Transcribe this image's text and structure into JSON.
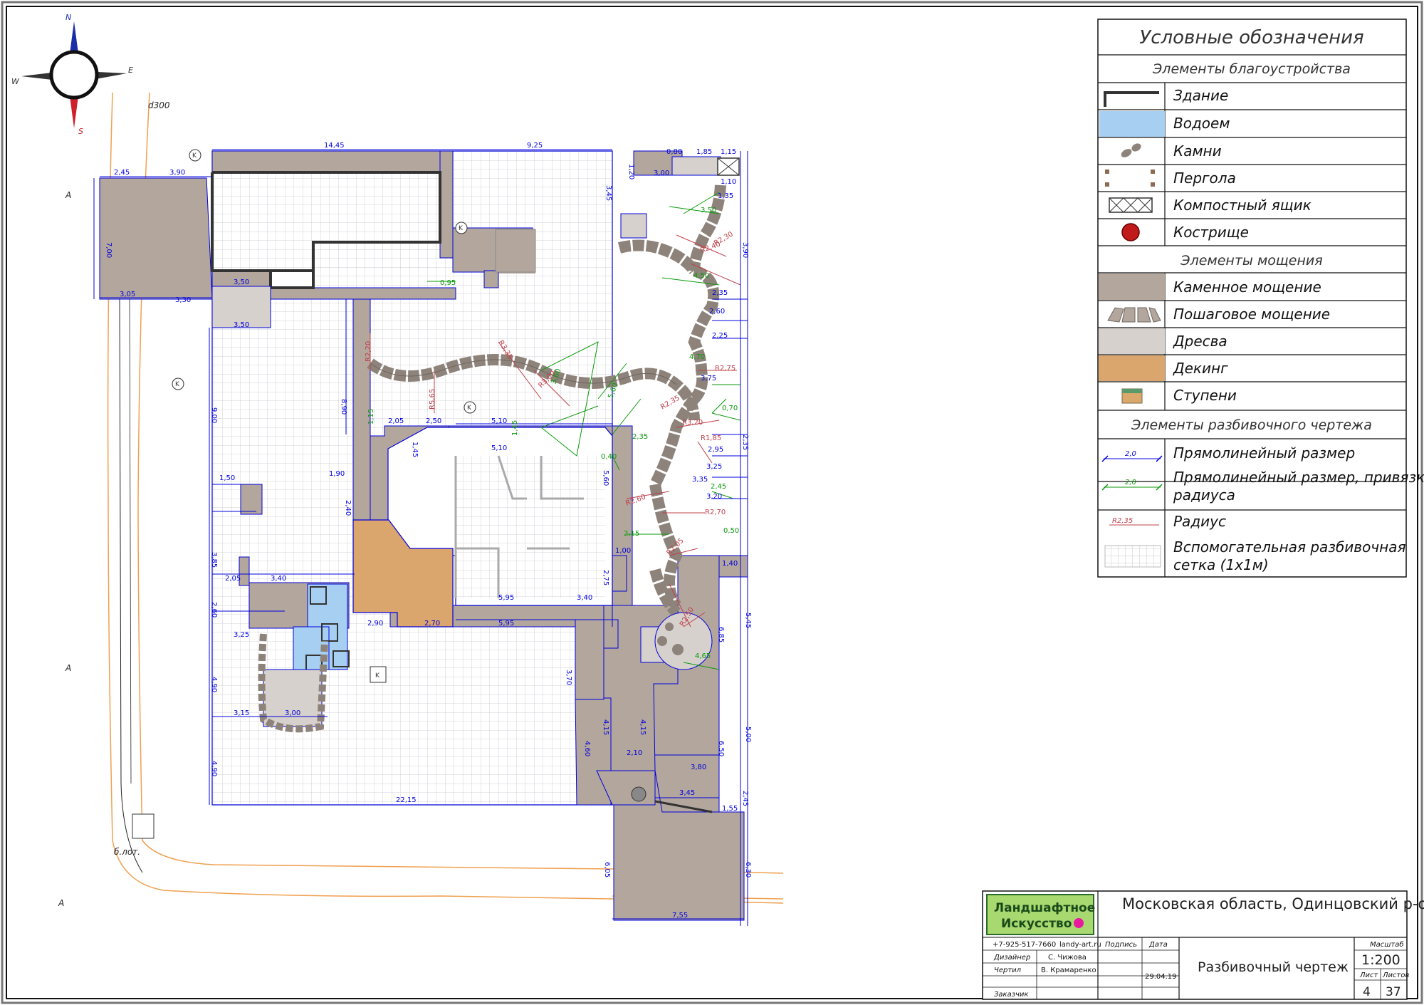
{
  "compass": {
    "n": "N",
    "e": "E",
    "s": "S",
    "w": "W"
  },
  "site_labels": {
    "pipe": "d300",
    "lot": "б.лот.",
    "a1": "A",
    "a2": "A",
    "a3": "A",
    "k1": "K",
    "k2": "K",
    "k3": "K",
    "k4": "K",
    "k5": "K"
  },
  "dims": {
    "d_1445": "14,45",
    "d_925": "9,25",
    "d_245": "2,45",
    "d_390": "3,90",
    "d_700": "7,00",
    "d_305": "3,05",
    "d_330": "3,30",
    "d_350a": "3,50",
    "d_350b": "3,50",
    "d_900": "9,00",
    "d_890": "8,90",
    "d_150": "1,50",
    "d_385": "3,85",
    "d_205": "2,05",
    "d_340": "3,40",
    "d_260": "2,60",
    "d_325": "3,25",
    "d_490a": "4,90",
    "d_490b": "4,90",
    "d_315": "3,15",
    "d_300": "3,00",
    "d_2215": "22,15",
    "d_510a": "5,10",
    "d_510b": "5,10",
    "d_595a": "5,95",
    "d_595b": "5,95",
    "d_340b": "3,40",
    "d_290": "2,90",
    "d_270": "2,70",
    "d_560": "5,60",
    "d_275": "2,75",
    "d_370": "3,70",
    "d_415a": "4,15",
    "d_415b": "4,15",
    "d_460": "4,60",
    "d_210": "2,10",
    "d_380": "3,80",
    "d_345": "3,45",
    "d_755": "7,55",
    "d_605": "6,05",
    "d_630": "6,30",
    "d_545": "5,45",
    "d_685": "6,85",
    "d_650": "6,50",
    "d_500": "5,00",
    "d_390b": "3,90",
    "d_235": "2,35",
    "d_295": "2,95",
    "d_325b": "3,25",
    "d_335": "3,35",
    "d_320": "3,20",
    "d_225": "2,25",
    "d_375": "3,75",
    "d_260b": "2,60",
    "d_235b": "2,35",
    "d_135": "1,35",
    "d_300b": "3,00",
    "d_110": "1,10",
    "d_080": "0,80",
    "d_185": "1,85",
    "d_115": "1,15",
    "d_120": "1,20",
    "d_345b": "3,45",
    "d_240": "2,40",
    "d_190": "1,90",
    "d_250": "2,50",
    "d_205b": "2,05",
    "d_145": "1,45",
    "d_100": "1,00",
    "d_140": "1,40",
    "d_155": "1,55",
    "d_245b": "2,45"
  },
  "radii": {
    "r1": "R2,20",
    "r2": "R3,35",
    "r3": "R5,65",
    "r4": "R3,00",
    "r5": "R2,40",
    "r6": "R2,30",
    "r7": "R2,75",
    "r8": "R2,35",
    "r9": "R3,20",
    "r10": "R1,85",
    "r11": "R2,60",
    "r12": "R2,70",
    "r13": "R2,05",
    "r14": "R2,50"
  },
  "green_dims": {
    "g1": "0,95",
    "g2": "3,60",
    "g3": "5,60",
    "g4": "4,70",
    "g5": "4,50",
    "g6": "3,50",
    "g7": "2,35",
    "g8": "0,50",
    "g9": "2,45",
    "g10": "2,15",
    "g11": "0,70",
    "g12": "4,65",
    "g13": "1,45",
    "g14": "0,40",
    "g15": "1,15"
  },
  "legend": {
    "title": "Условные обозначения",
    "section_landscape": "Элементы благоустройства",
    "building": "Здание",
    "pond": "Водоем",
    "stones": "Камни",
    "pergola": "Пергола",
    "compost": "Компостный ящик",
    "firepit": "Кострище",
    "section_paving": "Элементы мощения",
    "stone_paving": "Каменное мощение",
    "step_paving": "Пошаговое мощение",
    "wood_chips": "Дресва",
    "decking": "Декинг",
    "steps": "Ступени",
    "section_layout": "Элементы разбивочного чертежа",
    "dim_linear": "Прямолинейный размер",
    "dim_linear_radius": "Прямолинейный размер, привязка радиуса",
    "dim_linear_radius_l1": "Прямолинейный размер, привязка",
    "dim_linear_radius_l2": "радиуса",
    "radius": "Радиус",
    "grid": "Вспомогательная разбивочная сетка (1х1м)",
    "grid_l1": "Вспомогательная разбивочная",
    "grid_l2": "сетка (1х1м)",
    "sample_dim": "2,0",
    "sample_dim2": "2,0",
    "sample_radius": "R2,35"
  },
  "title_block": {
    "logo_line1": "Ландшафтное",
    "logo_line2": "Искусство",
    "phone": "+7-925-517-7660",
    "site": "landy-art.ru",
    "h_sign": "Подпись",
    "h_date": "Дата",
    "row1_role": "Дизайнер",
    "row1_name": "С. Чижова",
    "row2_role": "Чертил",
    "row2_name": "В. Крамаренко",
    "row2_date": "29.04.19",
    "row3_role": "Заказчик",
    "location": "Московская область, Одинцовский р-он,",
    "drawing": "Разбивочный чертеж",
    "scale_label": "Масштаб",
    "scale": "1:200",
    "sheet_label": "Лист",
    "sheets_label": "Листов",
    "sheet": "4",
    "sheets": "37"
  },
  "colors": {
    "stone": "#b3a79d",
    "pond": "#a6cff2",
    "chips": "#d6d1cc",
    "deck": "#dba56e",
    "dim": "#0000dd",
    "radius": "#c0404a",
    "green": "#0a9a0a",
    "grid": "#c8c8d0",
    "road": "#f0a050"
  }
}
